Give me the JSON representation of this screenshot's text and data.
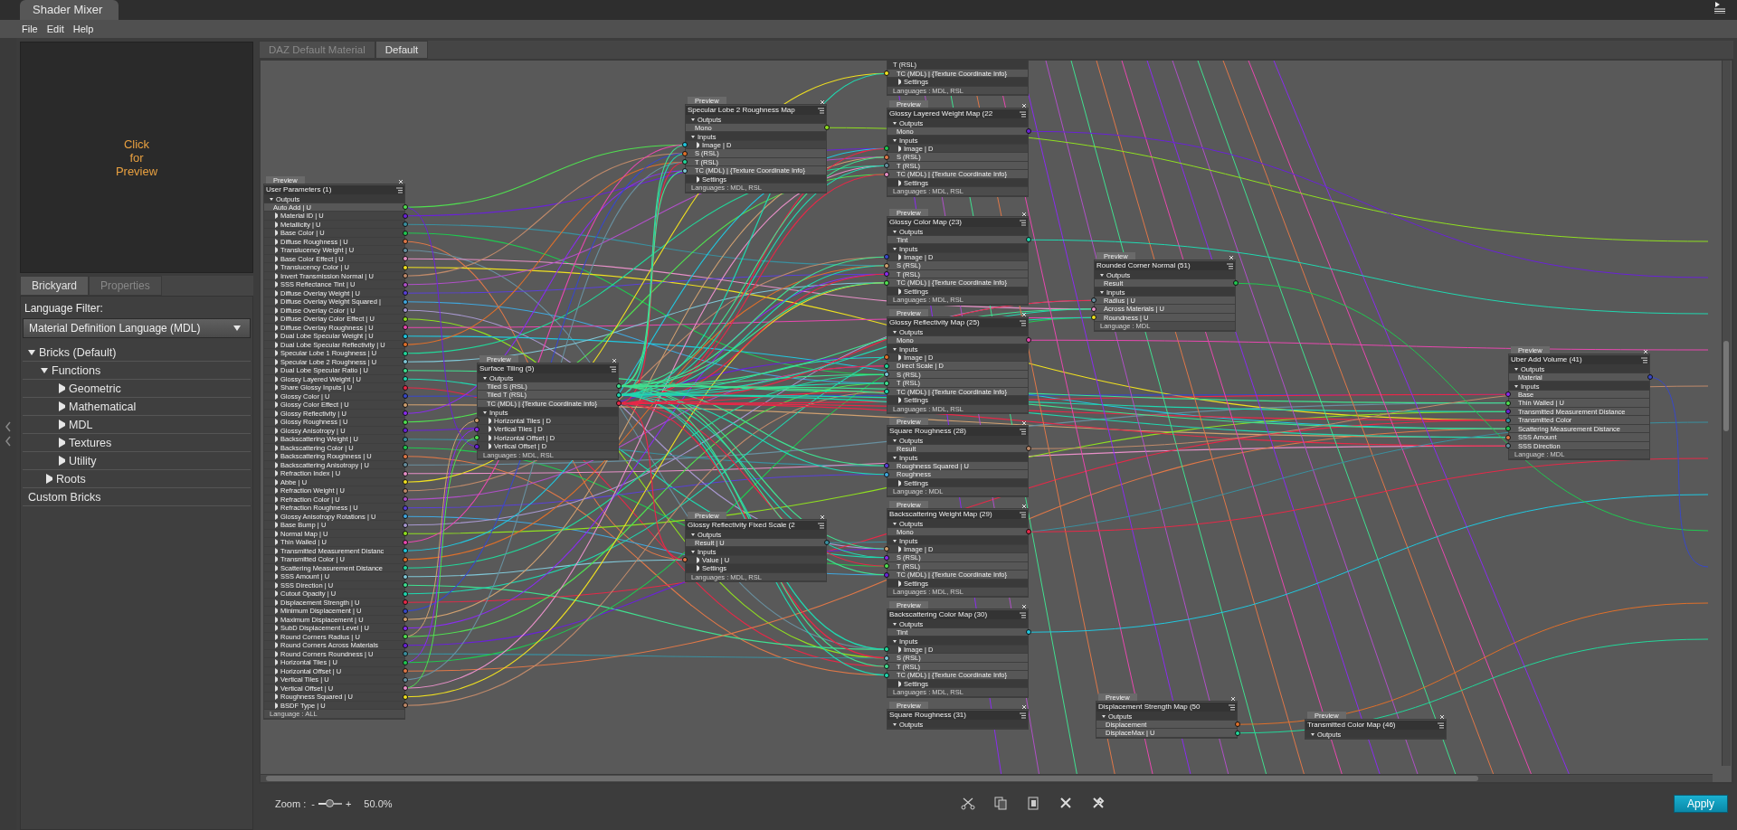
{
  "window": {
    "title": "Shader Mixer"
  },
  "menu": [
    "File",
    "Edit",
    "Help"
  ],
  "preview_panel": {
    "lines": [
      "Click",
      "for",
      "Preview"
    ]
  },
  "left_tabs": [
    {
      "label": "Brickyard",
      "selected": true
    },
    {
      "label": "Properties",
      "selected": false
    }
  ],
  "language_filter": {
    "label": "Language Filter:",
    "value": "Material Definition Language (MDL)"
  },
  "tree": [
    {
      "label": "Bricks (Default)",
      "expanded": true,
      "children": [
        {
          "label": "Functions",
          "expanded": true,
          "children": [
            {
              "label": "Geometric",
              "expanded": false
            },
            {
              "label": "Mathematical",
              "expanded": false
            },
            {
              "label": "MDL",
              "expanded": false
            },
            {
              "label": "Textures",
              "expanded": false
            },
            {
              "label": "Utility",
              "expanded": false
            }
          ]
        },
        {
          "label": "Roots",
          "expanded": false
        }
      ]
    },
    {
      "label": "Custom Bricks"
    }
  ],
  "doc_tabs": [
    {
      "label": "DAZ Default Material",
      "selected": false
    },
    {
      "label": "Default",
      "selected": true
    }
  ],
  "nodes": [
    {
      "preview": "Preview",
      "title": "User Parameters (1)",
      "items": [
        {
          "kind": "outputs",
          "label": "Outputs",
          "expanded": true
        },
        {
          "kind": "port",
          "label": "Auto Add | U"
        },
        {
          "kind": "group",
          "label": "Material ID | U",
          "expanded": false
        },
        {
          "kind": "group",
          "label": "Metallicity | U",
          "expanded": false
        },
        {
          "kind": "group",
          "label": "Base Color | U",
          "expanded": false
        },
        {
          "kind": "group",
          "label": "Diffuse Roughness | U",
          "expanded": false
        },
        {
          "kind": "group",
          "label": "Translucency Weight | U",
          "expanded": false
        },
        {
          "kind": "group",
          "label": "Base Color Effect | U",
          "expanded": false
        },
        {
          "kind": "group",
          "label": "Translucency Color | U",
          "expanded": false
        },
        {
          "kind": "group",
          "label": "Invert Transmission Normal | U",
          "expanded": false
        },
        {
          "kind": "group",
          "label": "SSS Reflectance Tint | U",
          "expanded": false
        },
        {
          "kind": "group",
          "label": "Diffuse Overlay Weight | U",
          "expanded": false
        },
        {
          "kind": "group",
          "label": "Diffuse Overlay Weight Squared |",
          "expanded": false
        },
        {
          "kind": "group",
          "label": "Diffuse Overlay Color | U",
          "expanded": false
        },
        {
          "kind": "group",
          "label": "Diffuse Overlay Color Effect | U",
          "expanded": false
        },
        {
          "kind": "group",
          "label": "Diffuse Overlay Roughness | U",
          "expanded": false
        },
        {
          "kind": "group",
          "label": "Dual Lobe Specular Weight | U",
          "expanded": false
        },
        {
          "kind": "group",
          "label": "Dual Lobe Specular Reflectivity | U",
          "expanded": false
        },
        {
          "kind": "group",
          "label": "Specular Lobe 1 Roughness | U",
          "expanded": false
        },
        {
          "kind": "group",
          "label": "Specular Lobe 2 Roughness | U",
          "expanded": false
        },
        {
          "kind": "group",
          "label": "Dual Lobe Specular Ratio | U",
          "expanded": false
        },
        {
          "kind": "group",
          "label": "Glossy Layered Weight | U",
          "expanded": false
        },
        {
          "kind": "group",
          "label": "Share Glossy Inputs | U",
          "expanded": false
        },
        {
          "kind": "group",
          "label": "Glossy Color | U",
          "expanded": false
        },
        {
          "kind": "group",
          "label": "Glossy Color Effect | U",
          "expanded": false
        },
        {
          "kind": "group",
          "label": "Glossy Reflectivity | U",
          "expanded": false
        },
        {
          "kind": "group",
          "label": "Glossy Roughness | U",
          "expanded": false
        },
        {
          "kind": "group",
          "label": "Glossy Anisotropy | U",
          "expanded": false
        },
        {
          "kind": "group",
          "label": "Backscattering Weight | U",
          "expanded": false
        },
        {
          "kind": "group",
          "label": "Backscattering Color | U",
          "expanded": false
        },
        {
          "kind": "group",
          "label": "Backscattering Roughness | U",
          "expanded": false
        },
        {
          "kind": "group",
          "label": "Backscattering Anisotropy | U",
          "expanded": false
        },
        {
          "kind": "group",
          "label": "Refraction Index | U",
          "expanded": false
        },
        {
          "kind": "group",
          "label": "Abbe | U",
          "expanded": false
        },
        {
          "kind": "group",
          "label": "Refraction Weight | U",
          "expanded": false
        },
        {
          "kind": "group",
          "label": "Refraction Color | U",
          "expanded": false
        },
        {
          "kind": "group",
          "label": "Refraction Roughness | U",
          "expanded": false
        },
        {
          "kind": "group",
          "label": "Glossy Anisotropy Rotations | U",
          "expanded": false
        },
        {
          "kind": "group",
          "label": "Base Bump | U",
          "expanded": false
        },
        {
          "kind": "group",
          "label": "Normal Map | U",
          "expanded": false
        },
        {
          "kind": "group",
          "label": "Thin Walled | U",
          "expanded": false
        },
        {
          "kind": "group",
          "label": "Transmitted Measurement Distanc",
          "expanded": false
        },
        {
          "kind": "group",
          "label": "Transmitted Color | U",
          "expanded": false
        },
        {
          "kind": "group",
          "label": "Scattering Measurement Distance",
          "expanded": false
        },
        {
          "kind": "group",
          "label": "SSS Amount | U",
          "expanded": false
        },
        {
          "kind": "group",
          "label": "SSS Direction | U",
          "expanded": false
        },
        {
          "kind": "group",
          "label": "Cutout Opacity | U",
          "expanded": false
        },
        {
          "kind": "group",
          "label": "Displacement Strength | U",
          "expanded": false
        },
        {
          "kind": "group",
          "label": "Minimum Displacement | U",
          "expanded": false
        },
        {
          "kind": "group",
          "label": "Maximum Displacement | U",
          "expanded": false
        },
        {
          "kind": "group",
          "label": "SubD Displacement Level | U",
          "expanded": false
        },
        {
          "kind": "group",
          "label": "Round Corners Radius | U",
          "expanded": false
        },
        {
          "kind": "group",
          "label": "Round Corners Across Materials",
          "expanded": false
        },
        {
          "kind": "group",
          "label": "Round Corners Roundness | U",
          "expanded": false
        },
        {
          "kind": "group",
          "label": "Horizontal Tiles | U",
          "expanded": false
        },
        {
          "kind": "group",
          "label": "Horizontal Offset | U",
          "expanded": false
        },
        {
          "kind": "group",
          "label": "Vertical Tiles | U",
          "expanded": false
        },
        {
          "kind": "group",
          "label": "Vertical Offset | U",
          "expanded": false
        },
        {
          "kind": "group",
          "label": "Roughness Squared | U",
          "expanded": false
        },
        {
          "kind": "group",
          "label": "BSDF Type | U",
          "expanded": false
        },
        {
          "kind": "footer",
          "label": "Language : ALL"
        }
      ]
    },
    {
      "preview": "Preview",
      "title": "Surface Tiling (5)",
      "items": [
        {
          "kind": "outputs",
          "label": "Outputs",
          "expanded": true
        },
        {
          "kind": "port",
          "label": "Tiled S (RSL)"
        },
        {
          "kind": "port",
          "label": "Tiled T (RSL)"
        },
        {
          "kind": "port",
          "label": "TC (MDL) | {Texture Coordinate Info}"
        },
        {
          "kind": "inputs",
          "label": "Inputs",
          "expanded": true
        },
        {
          "kind": "group",
          "label": "Horizontal Tiles | D",
          "expanded": false
        },
        {
          "kind": "group",
          "label": "Vertical Tiles | D",
          "expanded": false
        },
        {
          "kind": "group",
          "label": "Horizontal Offset | D",
          "expanded": false
        },
        {
          "kind": "group",
          "label": "Vertical Offset | D",
          "expanded": false
        },
        {
          "kind": "footer",
          "label": "Languages : MDL, RSL"
        }
      ]
    },
    {
      "preview": "Preview",
      "title": "Specular Lobe 2 Roughness Map",
      "items": [
        {
          "kind": "outputs",
          "label": "Outputs",
          "expanded": true
        },
        {
          "kind": "port",
          "label": "Mono"
        },
        {
          "kind": "inputs",
          "label": "Inputs",
          "expanded": true
        },
        {
          "kind": "group",
          "label": "Image | D",
          "expanded": false
        },
        {
          "kind": "port",
          "label": "S (RSL)"
        },
        {
          "kind": "port",
          "label": "T (RSL)"
        },
        {
          "kind": "port",
          "label": "TC (MDL) | {Texture Coordinate Info}"
        },
        {
          "kind": "settings",
          "label": "Settings",
          "expanded": false
        },
        {
          "kind": "footer",
          "label": "Languages : MDL, RSL"
        }
      ]
    },
    {
      "items": [
        {
          "kind": "inputs",
          "label": "T (RSL)"
        },
        {
          "kind": "port",
          "label": "TC (MDL) | {Texture Coordinate Info}"
        },
        {
          "kind": "settings",
          "label": "Settings",
          "expanded": false
        },
        {
          "kind": "footer",
          "label": "Languages : MDL, RSL"
        }
      ]
    },
    {
      "preview": "Preview",
      "title": "Glossy Layered Weight Map (22",
      "items": [
        {
          "kind": "outputs",
          "label": "Outputs",
          "expanded": true
        },
        {
          "kind": "port",
          "label": "Mono"
        },
        {
          "kind": "inputs",
          "label": "Inputs",
          "expanded": true
        },
        {
          "kind": "group",
          "label": "Image | D",
          "expanded": false
        },
        {
          "kind": "port",
          "label": "S (RSL)"
        },
        {
          "kind": "port",
          "label": "T (RSL)"
        },
        {
          "kind": "port",
          "label": "TC (MDL) | {Texture Coordinate Info}"
        },
        {
          "kind": "settings",
          "label": "Settings",
          "expanded": false
        },
        {
          "kind": "footer",
          "label": "Languages : MDL, RSL"
        }
      ]
    },
    {
      "preview": "Preview",
      "title": "Glossy Color Map (23)",
      "items": [
        {
          "kind": "outputs",
          "label": "Outputs",
          "expanded": true
        },
        {
          "kind": "port",
          "label": "Tint"
        },
        {
          "kind": "inputs",
          "label": "Inputs",
          "expanded": true
        },
        {
          "kind": "group",
          "label": "Image | D",
          "expanded": false
        },
        {
          "kind": "port",
          "label": "S (RSL)"
        },
        {
          "kind": "port",
          "label": "T (RSL)"
        },
        {
          "kind": "port",
          "label": "TC (MDL) | {Texture Coordinate Info}"
        },
        {
          "kind": "settings",
          "label": "Settings",
          "expanded": false
        },
        {
          "kind": "footer",
          "label": "Languages : MDL, RSL"
        }
      ]
    },
    {
      "preview": "Preview",
      "title": "Glossy Reflectivity Map (25)",
      "items": [
        {
          "kind": "outputs",
          "label": "Outputs",
          "expanded": true
        },
        {
          "kind": "port",
          "label": "Mono"
        },
        {
          "kind": "inputs",
          "label": "Inputs",
          "expanded": true
        },
        {
          "kind": "group",
          "label": "Image | D",
          "expanded": false
        },
        {
          "kind": "port",
          "label": "Direct Scale | D"
        },
        {
          "kind": "port",
          "label": "S (RSL)"
        },
        {
          "kind": "port",
          "label": "T (RSL)"
        },
        {
          "kind": "port",
          "label": "TC (MDL) | {Texture Coordinate Info}"
        },
        {
          "kind": "settings",
          "label": "Settings",
          "expanded": false
        },
        {
          "kind": "footer",
          "label": "Languages : MDL, RSL"
        }
      ]
    },
    {
      "preview": "Preview",
      "title": "Square Roughness (28)",
      "items": [
        {
          "kind": "outputs",
          "label": "Outputs",
          "expanded": true
        },
        {
          "kind": "port",
          "label": "Result"
        },
        {
          "kind": "inputs",
          "label": "Inputs",
          "expanded": true
        },
        {
          "kind": "port",
          "label": "Roughness Squared | U"
        },
        {
          "kind": "port",
          "label": "Roughness"
        },
        {
          "kind": "settings",
          "label": "Settings",
          "expanded": false
        },
        {
          "kind": "footer",
          "label": "Language : MDL"
        }
      ]
    },
    {
      "preview": "Preview",
      "title": "Glossy Reflectivity Fixed Scale (2",
      "items": [
        {
          "kind": "outputs",
          "label": "Outputs",
          "expanded": true
        },
        {
          "kind": "port",
          "label": "Result | U"
        },
        {
          "kind": "inputs",
          "label": "Inputs",
          "expanded": true
        },
        {
          "kind": "group",
          "label": "Value | U",
          "expanded": false
        },
        {
          "kind": "settings",
          "label": "Settings",
          "expanded": false
        },
        {
          "kind": "footer",
          "label": "Languages : MDL, RSL"
        }
      ]
    },
    {
      "preview": "Preview",
      "title": "Backscattering Weight Map (29)",
      "items": [
        {
          "kind": "outputs",
          "label": "Outputs",
          "expanded": true
        },
        {
          "kind": "port",
          "label": "Mono"
        },
        {
          "kind": "inputs",
          "label": "Inputs",
          "expanded": true
        },
        {
          "kind": "group",
          "label": "Image | D",
          "expanded": false
        },
        {
          "kind": "port",
          "label": "S (RSL)"
        },
        {
          "kind": "port",
          "label": "T (RSL)"
        },
        {
          "kind": "port",
          "label": "TC (MDL) | {Texture Coordinate Info}"
        },
        {
          "kind": "settings",
          "label": "Settings",
          "expanded": false
        },
        {
          "kind": "footer",
          "label": "Languages : MDL, RSL"
        }
      ]
    },
    {
      "preview": "Preview",
      "title": "Backscattering Color Map (30)",
      "items": [
        {
          "kind": "outputs",
          "label": "Outputs",
          "expanded": true
        },
        {
          "kind": "port",
          "label": "Tint"
        },
        {
          "kind": "inputs",
          "label": "Inputs",
          "expanded": true
        },
        {
          "kind": "group",
          "label": "Image | D",
          "expanded": false
        },
        {
          "kind": "port",
          "label": "S (RSL)"
        },
        {
          "kind": "port",
          "label": "T (RSL)"
        },
        {
          "kind": "port",
          "label": "TC (MDL) | {Texture Coordinate Info}"
        },
        {
          "kind": "settings",
          "label": "Settings",
          "expanded": false
        },
        {
          "kind": "footer",
          "label": "Languages : MDL, RSL"
        }
      ]
    },
    {
      "preview": "Preview",
      "title": "Square Roughness (31)",
      "items": [
        {
          "kind": "outputs",
          "label": "Outputs",
          "expanded": true
        }
      ]
    },
    {
      "preview": "Preview",
      "title": "Rounded Corner Normal (51)",
      "items": [
        {
          "kind": "outputs",
          "label": "Outputs",
          "expanded": true
        },
        {
          "kind": "port",
          "label": "Result"
        },
        {
          "kind": "inputs",
          "label": "Inputs",
          "expanded": true
        },
        {
          "kind": "port",
          "label": "Radius | U"
        },
        {
          "kind": "port",
          "label": "Across Materials | U"
        },
        {
          "kind": "port",
          "label": "Roundness | U"
        },
        {
          "kind": "footer",
          "label": "Language : MDL"
        }
      ]
    },
    {
      "preview": "Preview",
      "title": "Uber Add Volume (41)",
      "items": [
        {
          "kind": "outputs",
          "label": "Outputs",
          "expanded": true
        },
        {
          "kind": "port",
          "label": "Material"
        },
        {
          "kind": "inputs",
          "label": "Inputs",
          "expanded": true
        },
        {
          "kind": "port",
          "label": "Base"
        },
        {
          "kind": "port",
          "label": "Thin Walled | U"
        },
        {
          "kind": "port",
          "label": "Transmitted Measurement Distance"
        },
        {
          "kind": "port",
          "label": "Transmitted Color"
        },
        {
          "kind": "port",
          "label": "Scattering Measurement Distance"
        },
        {
          "kind": "port",
          "label": "SSS Amount"
        },
        {
          "kind": "port",
          "label": "SSS Direction"
        },
        {
          "kind": "footer",
          "label": "Language : MDL"
        }
      ]
    },
    {
      "preview": "Preview",
      "title": "Displacement Strength Map (50",
      "items": [
        {
          "kind": "outputs",
          "label": "Outputs",
          "expanded": true
        },
        {
          "kind": "port",
          "label": "Displacement"
        },
        {
          "kind": "port",
          "label": "DisplaceMax | U"
        }
      ]
    },
    {
      "preview": "Preview",
      "title": "Transmitted Color Map (46)",
      "items": [
        {
          "kind": "outputs",
          "label": "Outputs",
          "expanded": true
        }
      ]
    }
  ],
  "zoom": {
    "label": "Zoom :",
    "minus": "-",
    "plus": "+",
    "level": 0.5,
    "reading": "50.0%"
  },
  "apply_button": "Apply"
}
